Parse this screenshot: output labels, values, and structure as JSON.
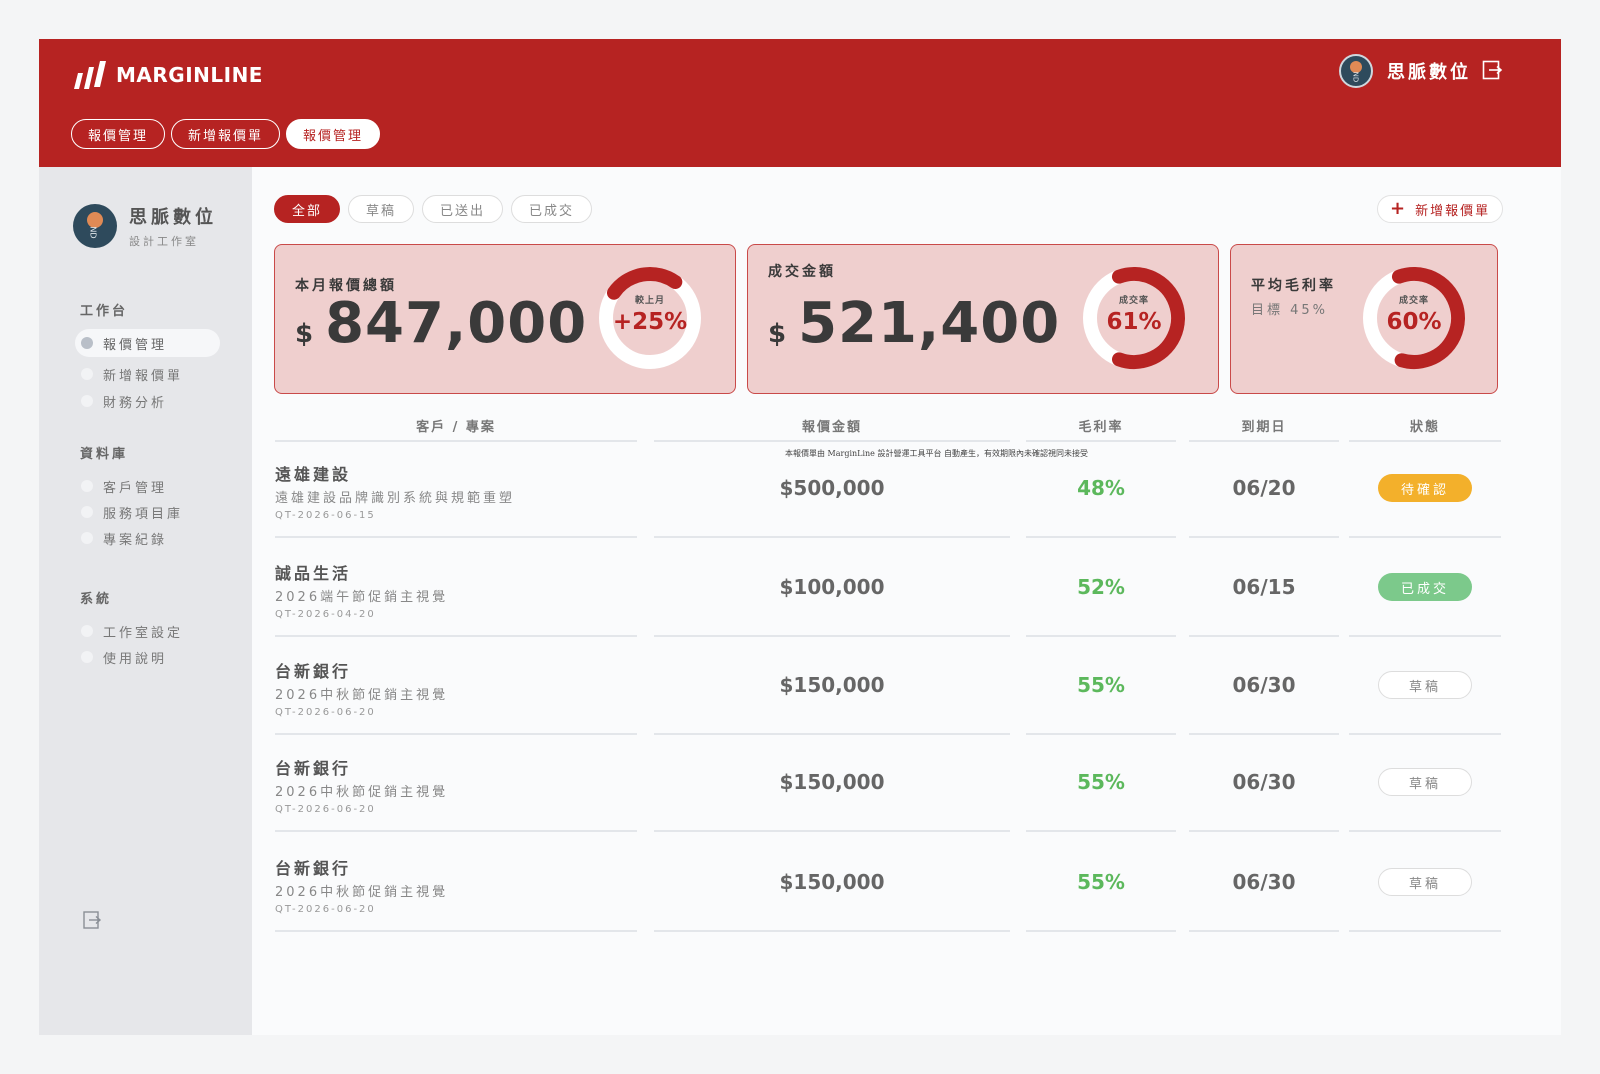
{
  "brand": {
    "name": "MARGINLINE"
  },
  "header": {
    "user_name": "思脈數位",
    "tabs": [
      {
        "label": "報價管理",
        "active": false
      },
      {
        "label": "新增報價單",
        "active": false
      },
      {
        "label": "報價管理",
        "active": true
      }
    ]
  },
  "sidebar": {
    "profile_name": "思脈數位",
    "profile_sub": "設計工作室",
    "sections": [
      {
        "title": "工作台",
        "items": [
          "報價管理",
          "新增報價單",
          "財務分析"
        ]
      },
      {
        "title": "資料庫",
        "items": [
          "客戶管理",
          "服務項目庫",
          "專案紀錄"
        ]
      },
      {
        "title": "系統",
        "items": [
          "工作室設定",
          "使用說明"
        ]
      }
    ],
    "active_item": "報價管理"
  },
  "filters": [
    {
      "label": "全部",
      "active": true
    },
    {
      "label": "草稿",
      "active": false
    },
    {
      "label": "已送出",
      "active": false
    },
    {
      "label": "已成交",
      "active": false
    }
  ],
  "add_button_label": "新增報價單",
  "cards": {
    "total": {
      "title": "本月報價總額",
      "currency": "$",
      "value": "847,000",
      "gauge_label": "較上月",
      "gauge_value": "+25%",
      "gauge_fraction": 0.25
    },
    "deal": {
      "title": "成交金額",
      "currency": "$",
      "value": "521,400",
      "gauge_label": "成交率",
      "gauge_value": "61%",
      "gauge_fraction": 0.61
    },
    "margin": {
      "title": "平均毛利率",
      "subtitle": "目標 45%",
      "gauge_label": "成交率",
      "gauge_value": "60%",
      "gauge_fraction": 0.6
    }
  },
  "table": {
    "headers": [
      "客戶 / 專案",
      "報價金額",
      "毛利率",
      "到期日",
      "狀態"
    ],
    "disclaimer": "本報價單由 MarginLine 設計營運工具平台 自動產生，有效期限內未確認視同未接受",
    "rows": [
      {
        "client": "遠雄建設",
        "project": "遠雄建設品牌識別系統與規範重塑",
        "code": "QT-2026-06-15",
        "amount": "$500,000",
        "margin": "48%",
        "due": "06/20",
        "status": "待確認",
        "status_type": "pending"
      },
      {
        "client": "誠品生活",
        "project": "2026端午節促銷主視覺",
        "code": "QT-2026-04-20",
        "amount": "$100,000",
        "margin": "52%",
        "due": "06/15",
        "status": "已成交",
        "status_type": "done"
      },
      {
        "client": "台新銀行",
        "project": "2026中秋節促銷主視覺",
        "code": "QT-2026-06-20",
        "amount": "$150,000",
        "margin": "55%",
        "due": "06/30",
        "status": "草稿",
        "status_type": "draft"
      },
      {
        "client": "台新銀行",
        "project": "2026中秋節促銷主視覺",
        "code": "QT-2026-06-20",
        "amount": "$150,000",
        "margin": "55%",
        "due": "06/30",
        "status": "草稿",
        "status_type": "draft"
      },
      {
        "client": "台新銀行",
        "project": "2026中秋節促銷主視覺",
        "code": "QT-2026-06-20",
        "amount": "$150,000",
        "margin": "55%",
        "due": "06/30",
        "status": "草稿",
        "status_type": "draft"
      }
    ]
  },
  "colors": {
    "brand_red": "#b62322",
    "card_bg": "#efcfce",
    "margin_green": "#5cb85c",
    "pending": "#f3b02b",
    "done": "#7cc98b"
  }
}
